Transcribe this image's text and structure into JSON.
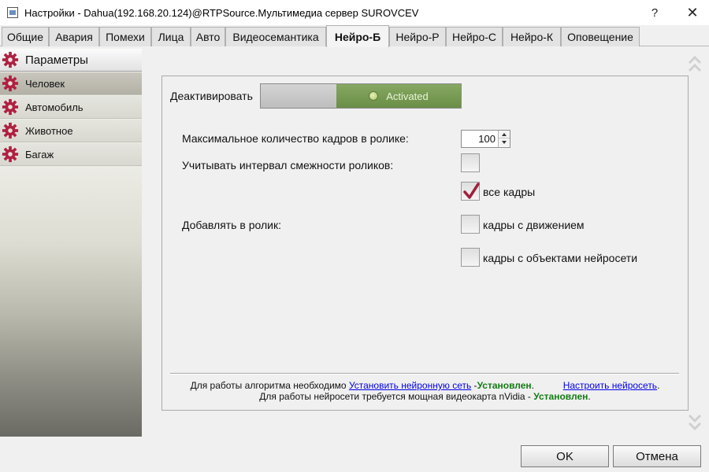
{
  "window": {
    "title": "Настройки - Dahua(192.168.20.124)@RTPSource.Мультимедиа сервер SUROVCEV",
    "help": "?",
    "close": "✕"
  },
  "tabs": [
    {
      "label": "Общие"
    },
    {
      "label": "Авария"
    },
    {
      "label": "Помехи"
    },
    {
      "label": "Лица"
    },
    {
      "label": "Авто"
    },
    {
      "label": "Видеосемантика"
    },
    {
      "label": "Нейро-Б",
      "active": true
    },
    {
      "label": "Нейро-Р"
    },
    {
      "label": "Нейро-С"
    },
    {
      "label": "Нейро-К"
    },
    {
      "label": "Оповещение"
    }
  ],
  "sidebar": {
    "items": [
      {
        "label": "Параметры",
        "selected": true,
        "icon": "gear-icon"
      },
      {
        "label": "Человек",
        "icon": "gear-icon"
      },
      {
        "label": "Автомобиль",
        "icon": "gear-icon"
      },
      {
        "label": "Животное",
        "icon": "gear-icon"
      },
      {
        "label": "Багаж",
        "icon": "gear-icon"
      }
    ]
  },
  "main": {
    "deactivate_label": "Деактивировать",
    "toggle_state": "Activated",
    "max_frames_label": "Максимальное количество кадров в ролике:",
    "max_frames_value": "100",
    "interval_label": "Учитывать интервал смежности роликов:",
    "add_to_clip_label": "Добавлять в ролик:",
    "options": [
      {
        "label": "все кадры",
        "checked": true
      },
      {
        "label": "кадры с движением",
        "checked": false
      },
      {
        "label": "кадры с объектами нейросети",
        "checked": false
      }
    ],
    "interval_checked": false
  },
  "info": {
    "line1_prefix": "Для работы алгоритма необходимо",
    "install_link": "Установить нейронную сеть",
    "line1_dash": " -",
    "installed1": "Установлен",
    "line1_dot": ".",
    "configure_link": "Настроить нейросеть",
    "line1_end": ".",
    "line2_prefix": "Для работы нейросети требуется мощная видеокарта nVidia -",
    "installed2": "Установлен",
    "line2_end": "."
  },
  "buttons": {
    "ok": "OK",
    "cancel": "Отмена"
  },
  "colors": {
    "accent_green": "#6b8e47",
    "status_green": "#157b15",
    "gear_red": "#b02040",
    "check_mark": "#a0203c"
  }
}
